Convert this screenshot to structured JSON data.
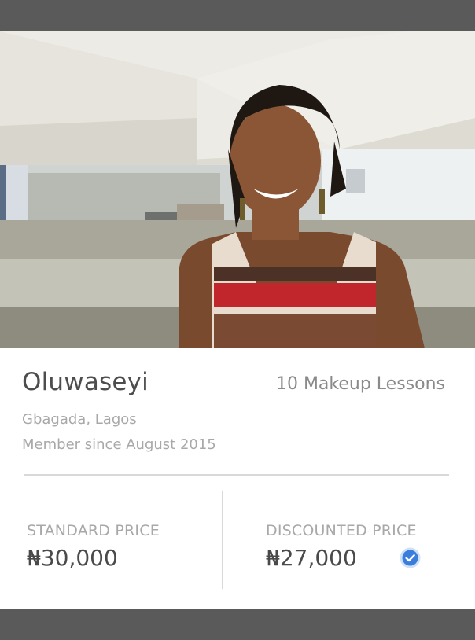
{
  "profile": {
    "name": "Oluwaseyi",
    "lessons": "10 Makeup Lessons",
    "location": "Gbagada, Lagos",
    "member_since": "Member since August 2015"
  },
  "pricing": {
    "standard_label": "STANDARD PRICE",
    "standard_value": "₦30,000",
    "discounted_label": "DISCOUNTED PRICE",
    "discounted_value": "₦27,000",
    "verified_icon": "check-circle-icon"
  },
  "colors": {
    "accent": "#3b7ddd",
    "text_primary": "#4d4d4d",
    "text_muted": "#a8a8a8"
  }
}
